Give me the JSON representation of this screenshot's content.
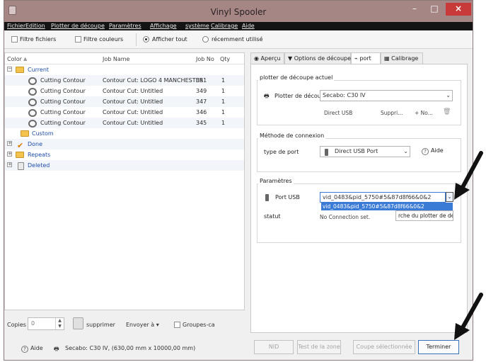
{
  "window": {
    "title": "Vinyl Spooler",
    "controls": {
      "minimize": "–",
      "maximize": "□",
      "close": "×"
    }
  },
  "menu": [
    "Fichier",
    "Edition",
    "Plotter de découpe",
    "Paramètres",
    "Affichage",
    "système",
    "Calibrage",
    "Aide"
  ],
  "toolbar": {
    "filter_files": "Filtre fichiers",
    "filter_colors": "Filtre couleurs",
    "show_all": "Afficher tout",
    "recent": "récemment utilisé"
  },
  "job_list": {
    "headers": {
      "color": "Color",
      "job_name": "Job Name",
      "job_no": "Job No",
      "qty": "Qty"
    },
    "groups": {
      "current": "Current",
      "custom": "Custom",
      "done": "Done",
      "repeats": "Repeats",
      "deleted": "Deleted"
    },
    "rows": [
      {
        "color": "Cutting Contour",
        "name": "Contour Cut: LOGO 4 MANCHESTER",
        "no": "351",
        "qty": "1"
      },
      {
        "color": "Cutting Contour",
        "name": "Contour Cut: Untitled",
        "no": "349",
        "qty": "1"
      },
      {
        "color": "Cutting Contour",
        "name": "Contour Cut: Untitled",
        "no": "347",
        "qty": "1"
      },
      {
        "color": "Cutting Contour",
        "name": "Contour Cut: Untitled",
        "no": "346",
        "qty": "1"
      },
      {
        "color": "Cutting Contour",
        "name": "Contour Cut: Untitled",
        "no": "345",
        "qty": "1"
      }
    ]
  },
  "left_bottom": {
    "copies_label": "Copies",
    "copies_value": "0",
    "delete": "supprimer",
    "send_to": "Envoyer à ▾",
    "groups": "Groupes-ca"
  },
  "tabs": [
    "Aperçu",
    "Options de découpe",
    "port",
    "Calibrage"
  ],
  "port_panel": {
    "current_plotter_title": "plotter de découpe actuel",
    "plotter_label": "Plotter de découp",
    "plotter_value": "Secabo: C30 IV",
    "connection_summary": "Direct USB",
    "delete_btn": "Suppri...",
    "new_btn": "+ No...",
    "connection_method_title": "Méthode de connexion",
    "port_type_label": "type de port",
    "port_type_value": "Direct USB Port",
    "help": "Aide",
    "params_title": "Paramètres",
    "usb_port_label": "Port USB",
    "usb_port_value": "vid_0483&pid_5750#5&87d8f66&0&2",
    "usb_port_option": "vid_0483&pid_5750#5&87d8f66&0&2",
    "status_label": "statut",
    "status_value": "No Connection set.",
    "search_btn": "rche du plotter de déc"
  },
  "footer": {
    "help": "Aide",
    "device_info": "Secabo: C30 IV,  (630,00 mm x 10000,00 mm)",
    "nid": "NID",
    "test_zone": "Test de la zone",
    "cut_selected": "Coupe sélectionnée",
    "finish": "Terminer"
  },
  "colors": {
    "title_bar": "#a68585",
    "menu_bar": "#141414",
    "selection": "#3a7bd5",
    "group_text": "#1f4fa8",
    "close_button": "#c83a3a"
  }
}
